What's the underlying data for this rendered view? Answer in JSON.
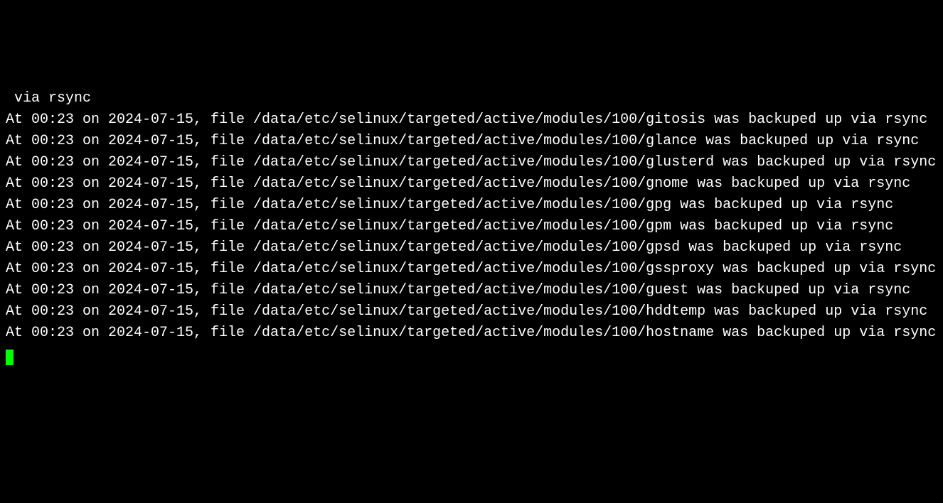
{
  "terminal": {
    "lines": [
      " via rsync",
      "At 00:23 on 2024-07-15, file /data/etc/selinux/targeted/active/modules/100/gitosis was backuped up via rsync",
      "At 00:23 on 2024-07-15, file /data/etc/selinux/targeted/active/modules/100/glance was backuped up via rsync",
      "At 00:23 on 2024-07-15, file /data/etc/selinux/targeted/active/modules/100/glusterd was backuped up via rsync",
      "At 00:23 on 2024-07-15, file /data/etc/selinux/targeted/active/modules/100/gnome was backuped up via rsync",
      "At 00:23 on 2024-07-15, file /data/etc/selinux/targeted/active/modules/100/gpg was backuped up via rsync",
      "At 00:23 on 2024-07-15, file /data/etc/selinux/targeted/active/modules/100/gpm was backuped up via rsync",
      "At 00:23 on 2024-07-15, file /data/etc/selinux/targeted/active/modules/100/gpsd was backuped up via rsync",
      "At 00:23 on 2024-07-15, file /data/etc/selinux/targeted/active/modules/100/gssproxy was backuped up via rsync",
      "At 00:23 on 2024-07-15, file /data/etc/selinux/targeted/active/modules/100/guest was backuped up via rsync",
      "At 00:23 on 2024-07-15, file /data/etc/selinux/targeted/active/modules/100/hddtemp was backuped up via rsync",
      "At 00:23 on 2024-07-15, file /data/etc/selinux/targeted/active/modules/100/hostname was backuped up via rsync"
    ]
  }
}
